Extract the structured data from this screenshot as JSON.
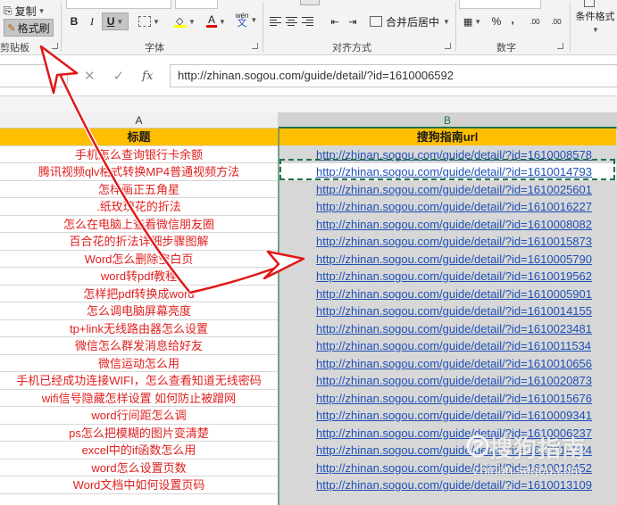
{
  "ribbon": {
    "clipboard": {
      "copy": "复制",
      "format_painter": "格式刷",
      "group_label": "剪贴板"
    },
    "font": {
      "bold": "B",
      "italic": "I",
      "underline": "U",
      "font_color_glyph": "A",
      "phonetic_top": "wén",
      "phonetic_bottom": "文",
      "group_label": "字体"
    },
    "alignment": {
      "merge_center": "合并后居中",
      "group_label": "对齐方式"
    },
    "number": {
      "percent": "%",
      "comma": ",",
      "inc_decimal": ".00",
      "dec_decimal": ".00",
      "group_label": "数字"
    },
    "styles": {
      "conditional_format": "条件格式"
    }
  },
  "formula_bar": {
    "fx_label": "fx",
    "cancel_glyph": "✕",
    "confirm_glyph": "✓",
    "formula": "http://zhinan.sogou.com/guide/detail/?id=1610006592"
  },
  "columns": {
    "a": "A",
    "b": "B"
  },
  "table": {
    "headers": [
      "标题",
      "搜狗指南url"
    ],
    "rows": [
      [
        "手机怎么查询银行卡余额",
        "http://zhinan.sogou.com/guide/detail/?id=1610008578"
      ],
      [
        "腾讯视频qlv格式转换MP4普通视频方法",
        "http://zhinan.sogou.com/guide/detail/?id=1610014793"
      ],
      [
        "怎样画正五角星",
        "http://zhinan.sogou.com/guide/detail/?id=1610025601"
      ],
      [
        ".纸玫瑰花的折法",
        "http://zhinan.sogou.com/guide/detail/?id=1610016227"
      ],
      [
        "怎么在电脑上查看微信朋友圈",
        "http://zhinan.sogou.com/guide/detail/?id=1610008082"
      ],
      [
        "百合花的折法详细步骤图解",
        "http://zhinan.sogou.com/guide/detail/?id=1610015873"
      ],
      [
        "Word怎么删除空白页",
        "http://zhinan.sogou.com/guide/detail/?id=1610005790"
      ],
      [
        "word转pdf教程",
        "http://zhinan.sogou.com/guide/detail/?id=1610019562"
      ],
      [
        "怎样把pdf转换成word",
        "http://zhinan.sogou.com/guide/detail/?id=1610005901"
      ],
      [
        "怎么调电脑屏幕亮度",
        "http://zhinan.sogou.com/guide/detail/?id=1610014155"
      ],
      [
        "tp+link无线路由器怎么设置",
        "http://zhinan.sogou.com/guide/detail/?id=1610023481"
      ],
      [
        "微信怎么群发消息给好友",
        "http://zhinan.sogou.com/guide/detail/?id=1610011534"
      ],
      [
        "微信运动怎么用",
        "http://zhinan.sogou.com/guide/detail/?id=1610010656"
      ],
      [
        "手机已经成功连接WIFI，怎么查看知道无线密码",
        "http://zhinan.sogou.com/guide/detail/?id=1610020873"
      ],
      [
        "wifi信号隐藏怎样设置 如何防止被蹭网",
        "http://zhinan.sogou.com/guide/detail/?id=1610015676"
      ],
      [
        "word行间距怎么调",
        "http://zhinan.sogou.com/guide/detail/?id=1610009341"
      ],
      [
        "ps怎么把模糊的图片变清楚",
        "http://zhinan.sogou.com/guide/detail/?id=1610006237"
      ],
      [
        "excel中的if函数怎么用",
        "http://zhinan.sogou.com/guide/detail/?id=1610014324"
      ],
      [
        "word怎么设置页数",
        "http://zhinan.sogou.com/guide/detail/?id=1610010452"
      ],
      [
        "Word文档中如何设置页码",
        "http://zhinan.sogou.com/guide/detail/?id=1610013109"
      ]
    ]
  },
  "watermark": {
    "brand": "搜狗指南",
    "domain": "zhinan.sogou.com"
  },
  "colors": {
    "header_fill": "#ffbf00",
    "title_text": "#e02020",
    "link_text": "#1f50b8",
    "arrow": "#e01818",
    "selection": "#217346"
  }
}
